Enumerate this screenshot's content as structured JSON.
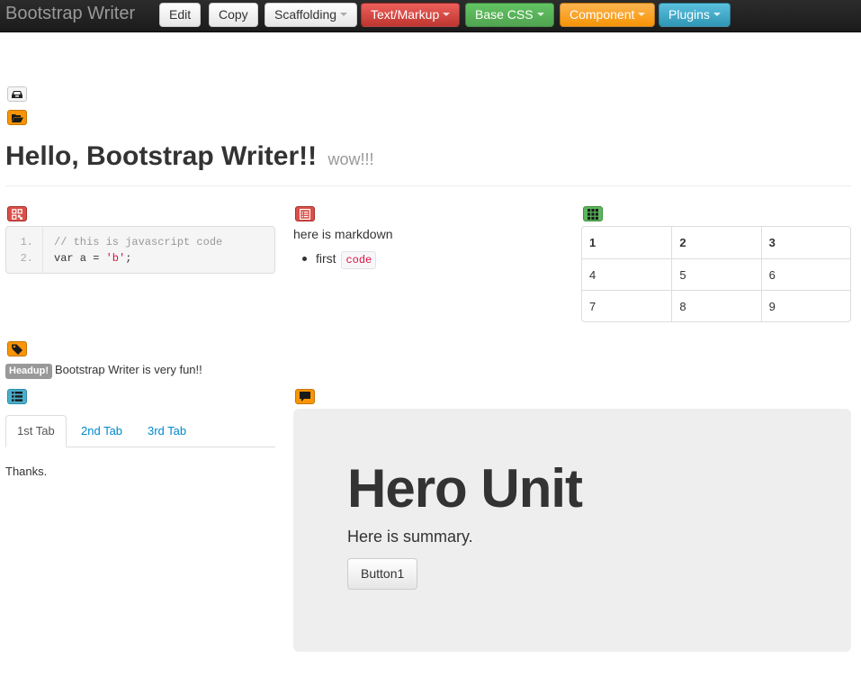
{
  "navbar": {
    "brand": "Bootstrap Writer",
    "buttons": [
      {
        "label": "Edit"
      },
      {
        "label": "Copy"
      },
      {
        "label": "Scaffolding"
      },
      {
        "label": "Text/Markup"
      },
      {
        "label": "Base CSS"
      },
      {
        "label": "Component"
      },
      {
        "label": "Plugins"
      }
    ]
  },
  "icons": {
    "inbox": "inbox-icon",
    "folder": "folder-open-icon",
    "qrcode": "qrcode-icon",
    "list_alt": "list-alt-icon",
    "table": "table-grid-icon",
    "tag": "tag-icon",
    "list": "list-icon",
    "comment": "comment-icon"
  },
  "colors": {
    "danger": "#da4f49",
    "success": "#5bb75b",
    "warning": "#f89406",
    "info": "#49afcd",
    "link": "#0088cc"
  },
  "header": {
    "title": "Hello, Bootstrap Writer!!",
    "subtitle": "wow!!!"
  },
  "code": {
    "line_numbers": [
      "1.",
      "2."
    ],
    "line1": "// this is javascript code",
    "line2_pre": "var a = ",
    "line2_str": "'b'",
    "line2_post": ";"
  },
  "markdown": {
    "text": "here is markdown",
    "item_text": "first",
    "item_code": "code"
  },
  "table": {
    "header": [
      "1",
      "2",
      "3"
    ],
    "rows": [
      [
        "4",
        "5",
        "6"
      ],
      [
        "7",
        "8",
        "9"
      ]
    ]
  },
  "label": {
    "badge": "Headup!",
    "text": "Bootstrap Writer is very fun!!"
  },
  "tabs": {
    "items": [
      "1st Tab",
      "2nd Tab",
      "3rd Tab"
    ],
    "active_content": "Thanks."
  },
  "hero": {
    "title": "Hero Unit",
    "summary": "Here is summary.",
    "button": "Button1"
  }
}
